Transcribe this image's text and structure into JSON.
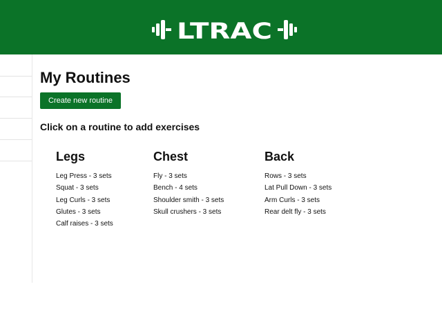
{
  "header": {
    "logo_text": "LTRAC",
    "background_color": "#0b7328",
    "logo_icon": "dumbbell-logo"
  },
  "sidebar": {
    "items": [
      {},
      {},
      {},
      {},
      {}
    ]
  },
  "main": {
    "title": "My Routines",
    "create_button_label": "Create new routine",
    "instructions": "Click on a routine to add exercises",
    "routines": [
      {
        "name": "Legs",
        "exercises": [
          "Leg Press - 3 sets",
          "Squat - 3 sets",
          "Leg Curls - 3 sets",
          "Glutes - 3 sets",
          "Calf raises - 3 sets"
        ]
      },
      {
        "name": "Chest",
        "exercises": [
          "Fly - 3 sets",
          "Bench - 4 sets",
          "Shoulder smith - 3 sets",
          "Skull crushers - 3 sets"
        ]
      },
      {
        "name": "Back",
        "exercises": [
          "Rows - 3 sets",
          "Lat Pull Down - 3 sets",
          "Arm Curls - 3 sets",
          "Rear delt fly - 3 sets"
        ]
      }
    ]
  },
  "colors": {
    "accent": "#0b7328",
    "text": "#111111",
    "button_text": "#ffffff"
  }
}
